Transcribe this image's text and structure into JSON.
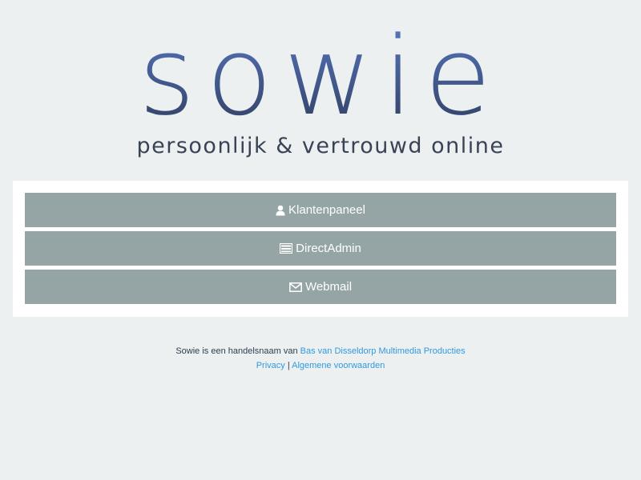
{
  "logo": {
    "wordmark": "sowie",
    "tagline": "persoonlijk & vertrouwd online",
    "colors": {
      "top": "#5b7bc8",
      "bottom": "#2e3c5a",
      "tagline": "#3a4356"
    }
  },
  "buttons": [
    {
      "label": "Klantenpaneel",
      "icon": "user-icon"
    },
    {
      "label": "DirectAdmin",
      "icon": "server-icon"
    },
    {
      "label": "Webmail",
      "icon": "envelope-icon"
    }
  ],
  "footer": {
    "prefix": "Sowie is een handelsnaam van",
    "company_link": "Bas van Disseldorp Multimedia Producties",
    "privacy_link": "Privacy",
    "separator": "|",
    "terms_link": "Algemene voorwaarden"
  },
  "colors": {
    "background": "#ecf0f1",
    "button": "#95a5a6",
    "link": "#3498db",
    "text": "#2c3e50"
  }
}
